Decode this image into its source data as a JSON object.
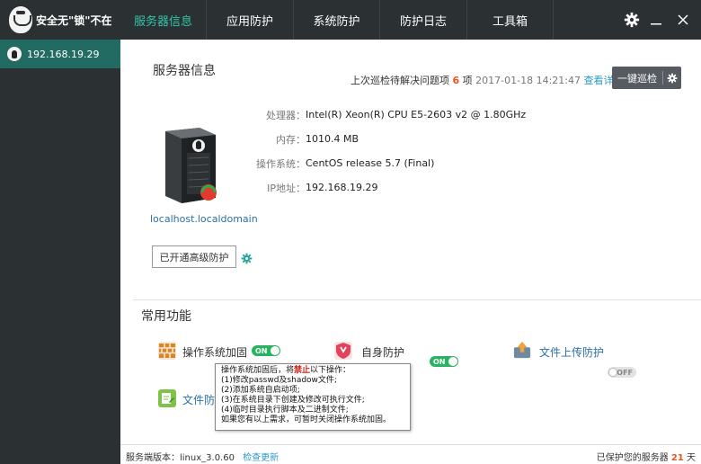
{
  "app": {
    "logo_text": "安全无\"锁\"不在"
  },
  "nav": {
    "tabs": [
      {
        "label": "服务器信息",
        "active": true
      },
      {
        "label": "应用防护",
        "active": false
      },
      {
        "label": "系统防护",
        "active": false
      },
      {
        "label": "防护日志",
        "active": false
      },
      {
        "label": "工具箱",
        "active": false
      }
    ],
    "window_controls": [
      "gear-icon",
      "minimize-icon",
      "close-icon"
    ]
  },
  "sidebar": {
    "items": [
      {
        "label": "192.168.19.29",
        "icon": "linux-tux-icon",
        "selected": true
      }
    ]
  },
  "server_info": {
    "title": "服务器信息",
    "inspect": {
      "prefix": "上次巡检待解决问题项",
      "count": "6",
      "unit": "项",
      "timestamp": "2017-01-18 14:21:47",
      "details_link": "查看详情"
    },
    "inspect_button": "一键巡检",
    "hostname": "localhost.localdomain",
    "fields": [
      {
        "label": "处理器：",
        "value": "Intel(R) Xeon(R) CPU E5-2603 v2 @ 1.80GHz"
      },
      {
        "label": "内存：",
        "value": "1010.4 MB"
      },
      {
        "label": "操作系统：",
        "value": "CentOS release 5.7 (Final)"
      },
      {
        "label": "IP地址：",
        "value": "192.168.19.29"
      }
    ],
    "advanced_button": "已开通高级防护"
  },
  "common": {
    "title": "常用功能",
    "features": [
      {
        "label": "操作系统加固",
        "toggle": "ON",
        "state": "on",
        "icon": "firewall-brick-icon"
      },
      {
        "label": "自身防护",
        "toggle": "ON",
        "state": "on",
        "icon": "shield-icon"
      },
      {
        "label": "文件上传防护",
        "toggle": "OFF",
        "state": "off",
        "icon": "upload-icon"
      },
      {
        "label": "文件防",
        "icon": "file-edit-icon"
      }
    ]
  },
  "tooltip": {
    "line1_pre": "操作系统加固后，将",
    "line1_red": "禁止",
    "line1_post": "以下操作：",
    "lines": [
      "(1)修改passwd及shadow文件;",
      "(2)添加系统自启动项;",
      "(3)在系统目录下创建及修改可执行文件;",
      "(4)临时目录执行脚本及二进制文件;",
      "如果您有以上需求，可暂时关闭操作系统加固。"
    ]
  },
  "footer": {
    "version_label": "服务端版本：",
    "version": "linux_3.0.60",
    "check_update": "检查更新",
    "protected_prefix": "已保护您的服务器",
    "days": "21",
    "days_unit": "天"
  },
  "colors": {
    "topbar": "#2b3033",
    "active_tab": "#33c4a7",
    "sidebar_selected": "#226b62",
    "accent_orange": "#e8541e",
    "link": "#2a9ac4",
    "toggle_on": "#27b35f"
  }
}
